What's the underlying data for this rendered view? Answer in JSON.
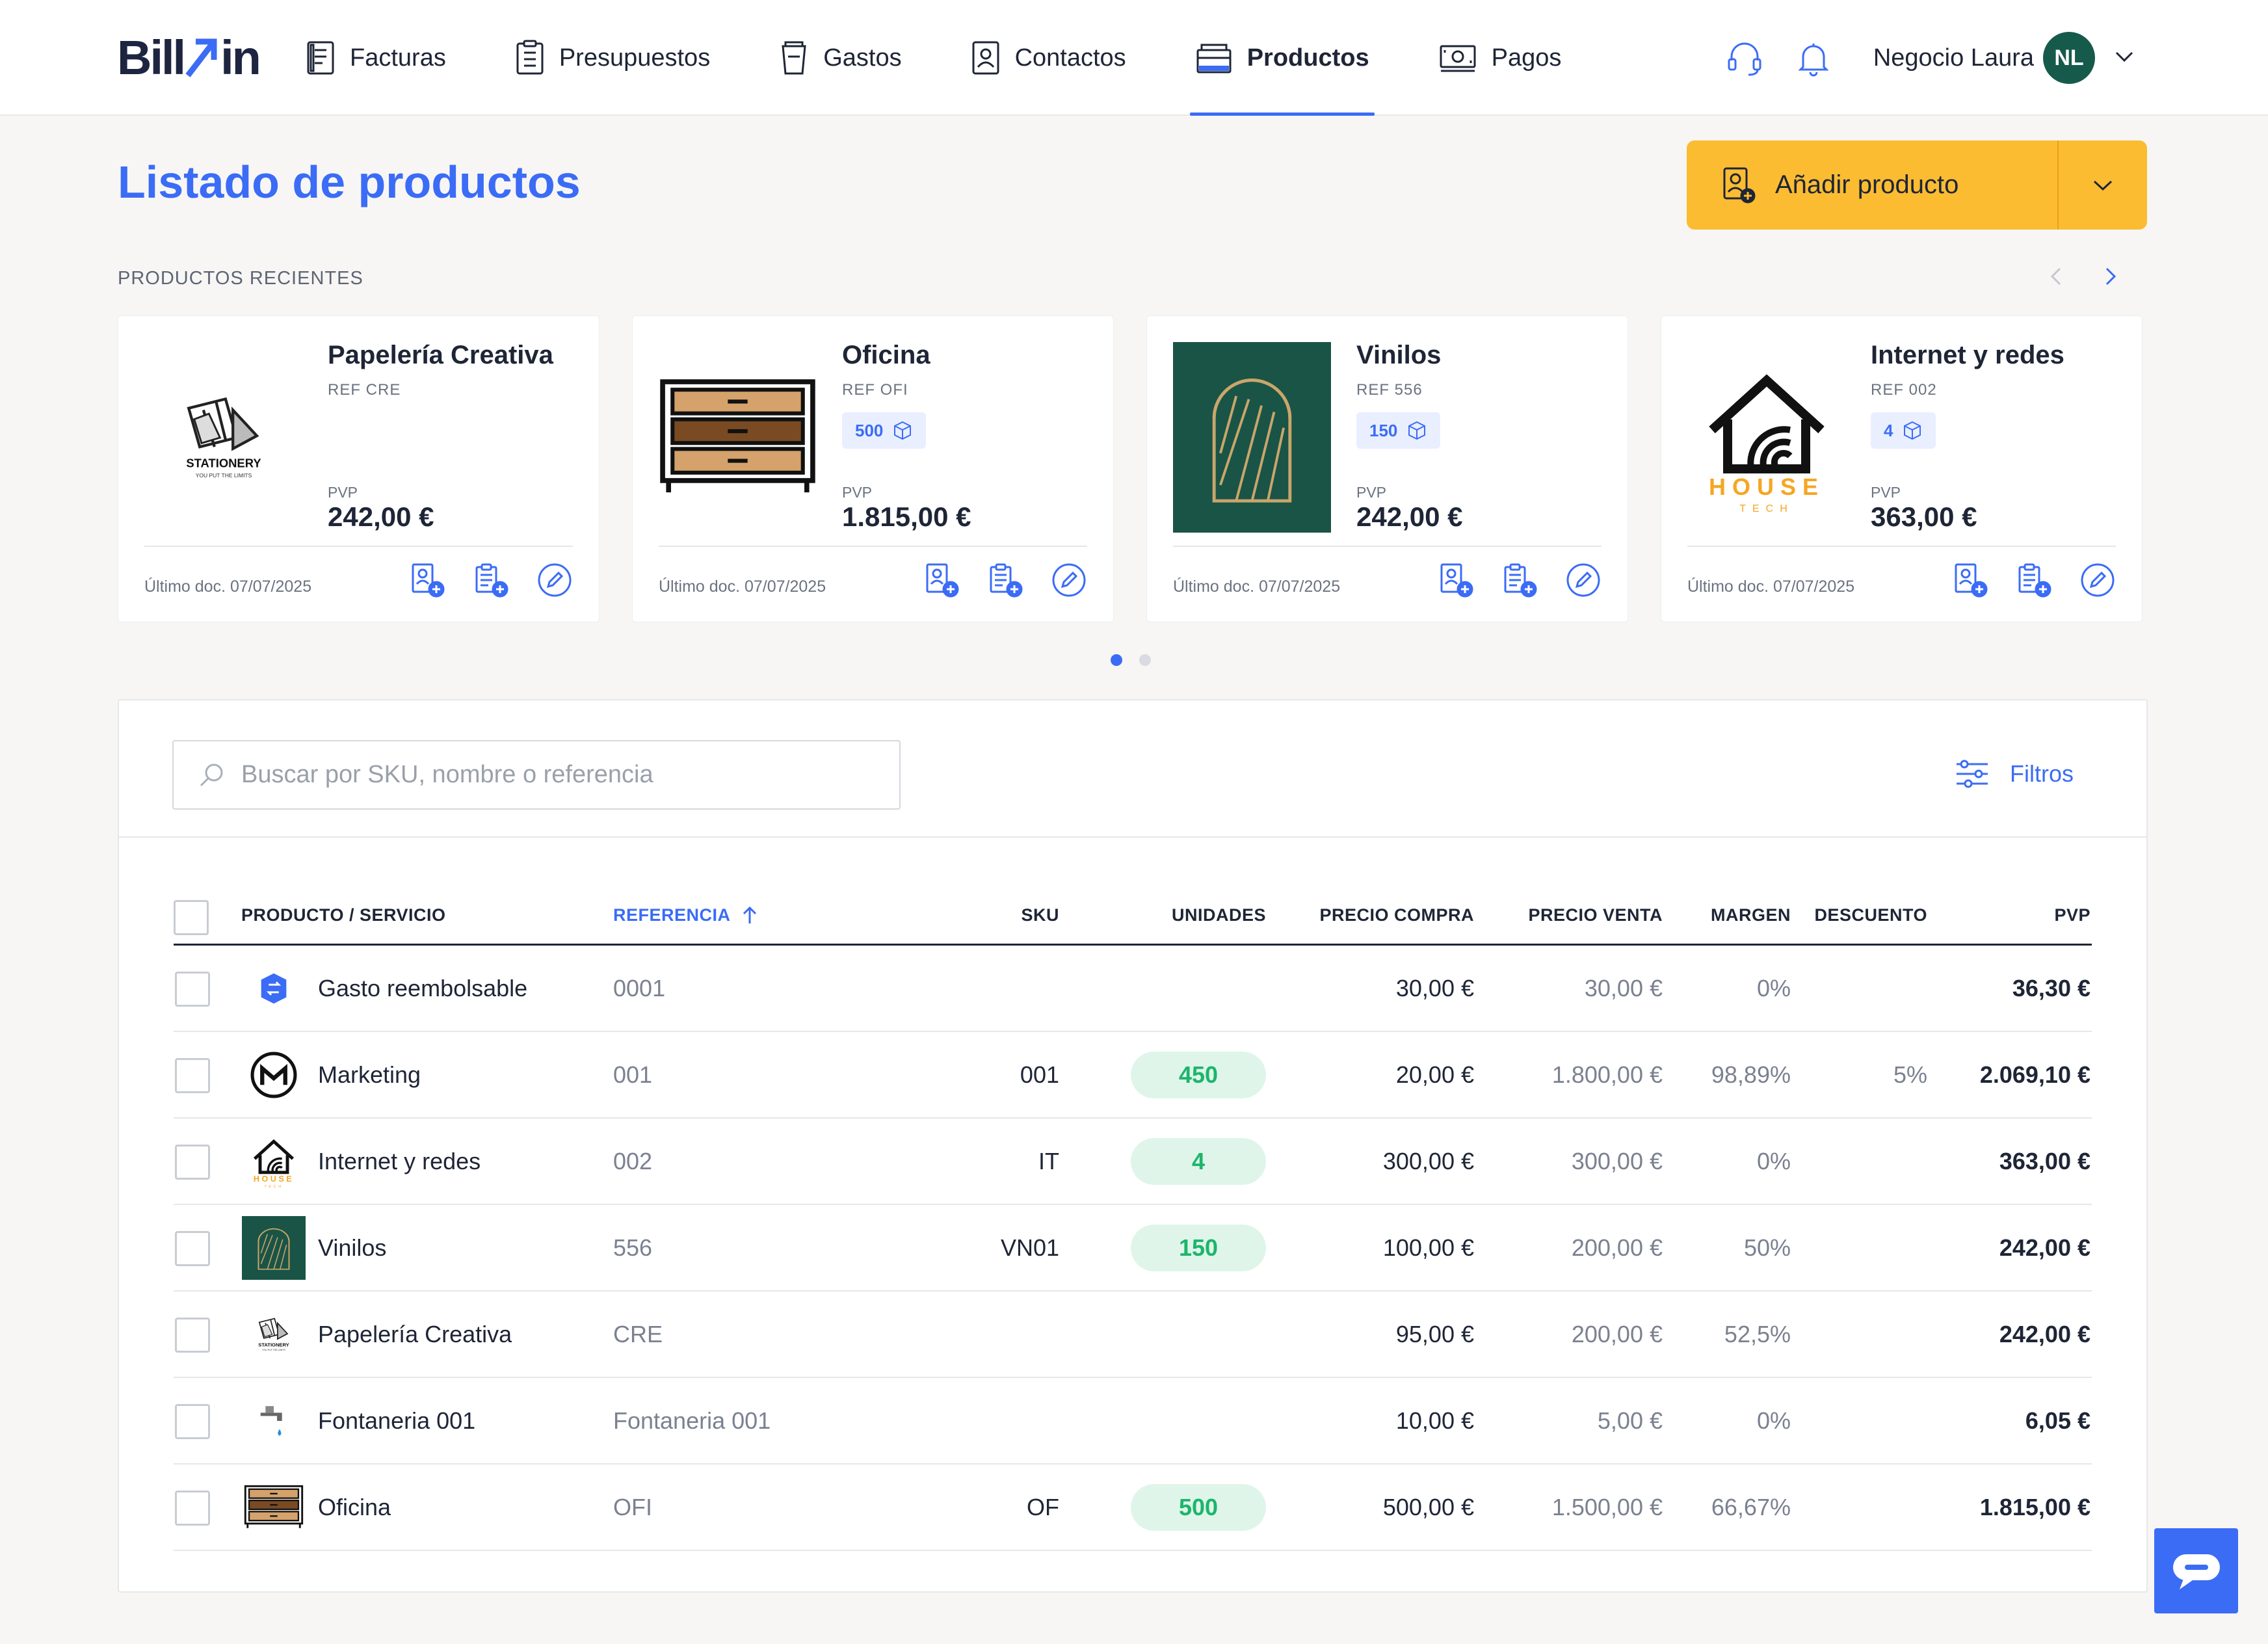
{
  "brand": {
    "logo_text": "Billin"
  },
  "nav": {
    "items": [
      {
        "label": "Facturas",
        "icon": "invoice-icon"
      },
      {
        "label": "Presupuestos",
        "icon": "quote-icon"
      },
      {
        "label": "Gastos",
        "icon": "expense-icon"
      },
      {
        "label": "Contactos",
        "icon": "contact-icon"
      },
      {
        "label": "Productos",
        "icon": "product-icon",
        "active": true
      },
      {
        "label": "Pagos",
        "icon": "payment-icon"
      }
    ]
  },
  "user": {
    "company": "Negocio Laura",
    "initials": "NL"
  },
  "page": {
    "title": "Listado de productos",
    "add_button": "Añadir producto",
    "recent_label": "PRODUCTOS RECIENTES"
  },
  "recent": [
    {
      "name": "Papelería Creativa",
      "ref": "REF CRE",
      "units": "",
      "pvp_label": "PVP",
      "pvp": "242,00 €",
      "last_doc": "Último doc. 07/07/2025",
      "thumb": "stationery-logo"
    },
    {
      "name": "Oficina",
      "ref": "REF OFI",
      "units": "500",
      "pvp_label": "PVP",
      "pvp": "1.815,00 €",
      "last_doc": "Último doc. 07/07/2025",
      "thumb": "drawer-cabinet"
    },
    {
      "name": "Vinilos",
      "ref": "REF 556",
      "units": "150",
      "pvp_label": "PVP",
      "pvp": "242,00 €",
      "last_doc": "Último doc. 07/07/2025",
      "thumb": "vinyl-arch"
    },
    {
      "name": "Internet y redes",
      "ref": "REF 002",
      "units": "4",
      "pvp_label": "PVP",
      "pvp": "363,00 €",
      "last_doc": "Último doc. 07/07/2025",
      "thumb": "house-tech-logo"
    }
  ],
  "thumb_text": {
    "stationery": "STATIONERY",
    "stationery_tag": "YOU PUT THE LIMITS",
    "house": "HOUSE",
    "tech": "TECH"
  },
  "carousel": {
    "pages": 2,
    "current": 1
  },
  "search": {
    "placeholder": "Buscar por SKU, nombre o referencia",
    "value": ""
  },
  "filters_label": "Filtros",
  "table": {
    "headers": {
      "product": "PRODUCTO / SERVICIO",
      "reference": "REFERENCIA",
      "sku": "SKU",
      "units": "UNIDADES",
      "buy": "PRECIO COMPRA",
      "sell": "PRECIO VENTA",
      "margin": "MARGEN",
      "discount": "DESCUENTO",
      "pvp": "PVP"
    },
    "rows": [
      {
        "name": "Gasto reembolsable",
        "ref": "0001",
        "sku": "",
        "units": "",
        "buy": "30,00 €",
        "sell": "30,00 €",
        "margin": "0%",
        "discount": "",
        "pvp": "36,30 €",
        "icon": "refund-icon"
      },
      {
        "name": "Marketing",
        "ref": "001",
        "sku": "001",
        "units": "450",
        "buy": "20,00 €",
        "sell": "1.800,00 €",
        "margin": "98,89%",
        "discount": "5%",
        "pvp": "2.069,10 €",
        "icon": "marketing-logo"
      },
      {
        "name": "Internet y redes",
        "ref": "002",
        "sku": "IT",
        "units": "4",
        "buy": "300,00 €",
        "sell": "300,00 €",
        "margin": "0%",
        "discount": "",
        "pvp": "363,00 €",
        "icon": "house-tech-logo"
      },
      {
        "name": "Vinilos",
        "ref": "556",
        "sku": "VN01",
        "units": "150",
        "buy": "100,00 €",
        "sell": "200,00 €",
        "margin": "50%",
        "discount": "",
        "pvp": "242,00 €",
        "icon": "vinyl-arch"
      },
      {
        "name": "Papelería Creativa",
        "ref": "CRE",
        "sku": "",
        "units": "",
        "buy": "95,00 €",
        "sell": "200,00 €",
        "margin": "52,5%",
        "discount": "",
        "pvp": "242,00 €",
        "icon": "stationery-logo"
      },
      {
        "name": "Fontaneria 001",
        "ref": "Fontaneria 001",
        "sku": "",
        "units": "",
        "buy": "10,00 €",
        "sell": "5,00 €",
        "margin": "0%",
        "discount": "",
        "pvp": "6,05 €",
        "icon": "faucet-icon"
      },
      {
        "name": "Oficina",
        "ref": "OFI",
        "sku": "OF",
        "units": "500",
        "buy": "500,00 €",
        "sell": "1.500,00 €",
        "margin": "66,67%",
        "discount": "",
        "pvp": "1.815,00 €",
        "icon": "drawer-cabinet"
      }
    ]
  },
  "colors": {
    "accent": "#3b6cf6",
    "cta": "#fbbc32",
    "success": "#1db56b",
    "avatar": "#165a4b"
  }
}
